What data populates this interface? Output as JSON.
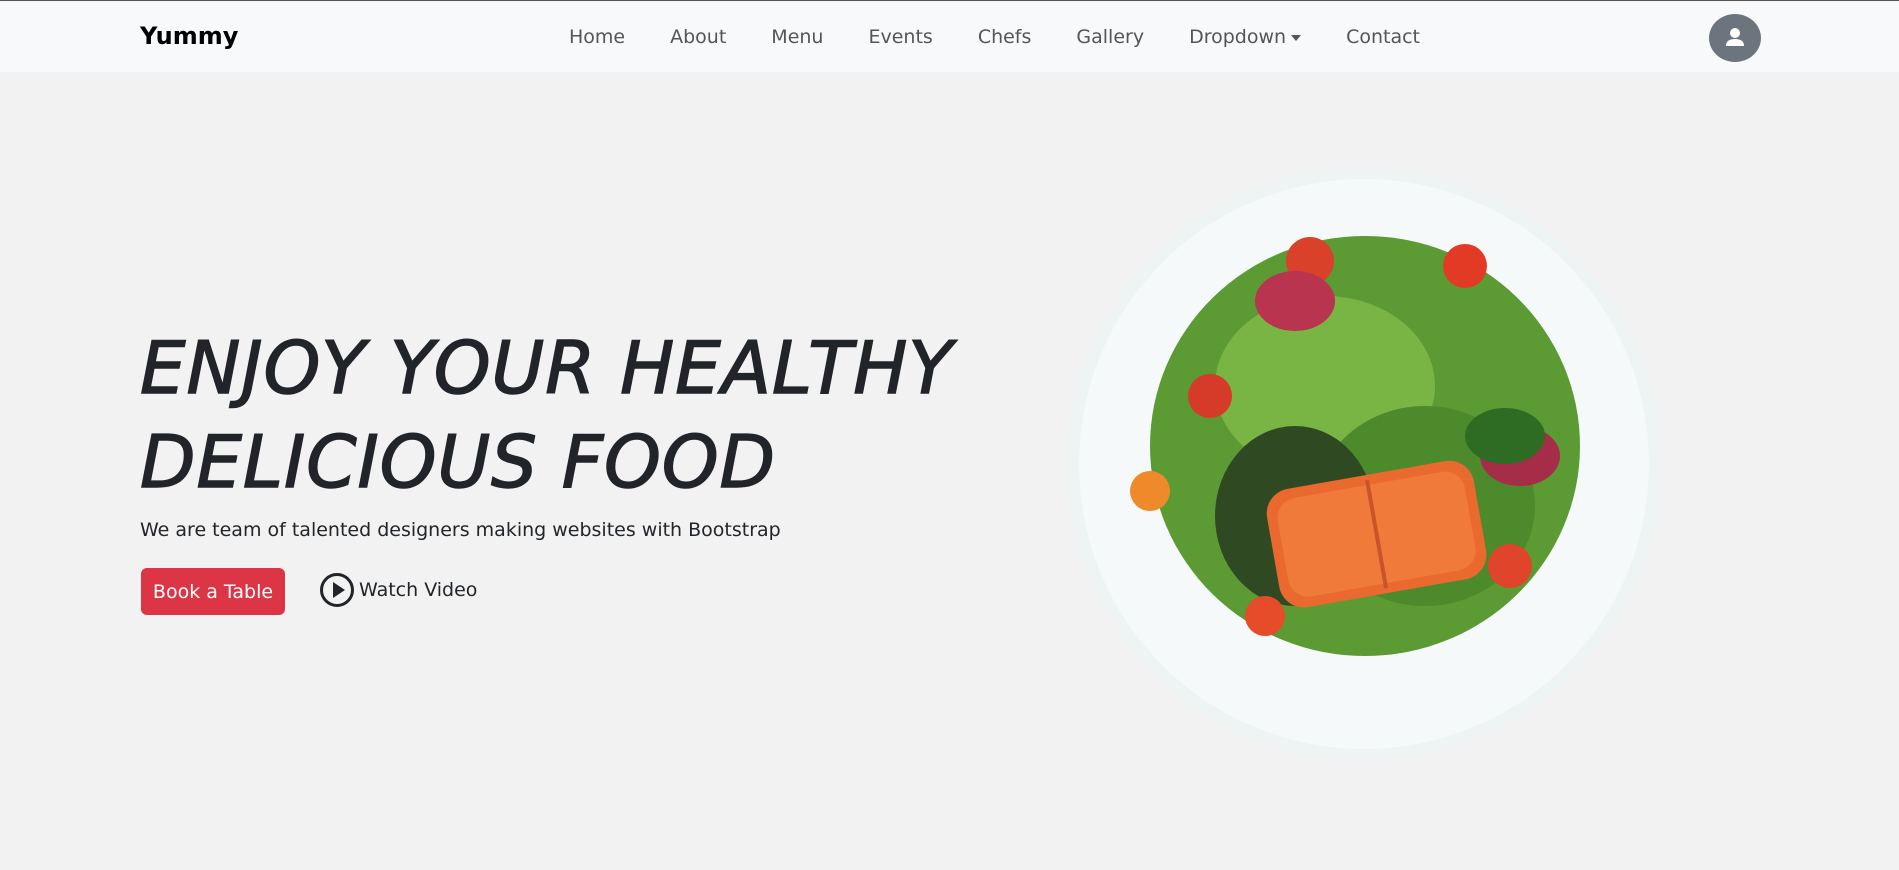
{
  "navbar": {
    "brand": "Yummy",
    "links": [
      "Home",
      "About",
      "Menu",
      "Events",
      "Chefs",
      "Gallery",
      "Dropdown",
      "Contact"
    ]
  },
  "hero": {
    "title_line1": "ENJOY YOUR HEALTHY",
    "title_line2": "DELICIOUS FOOD",
    "subtitle": "We are team of talented designers making websites with Bootstrap",
    "book_button": "Book a Table",
    "watch_video": "Watch Video"
  },
  "colors": {
    "accent": "#dc3545",
    "background": "#f2f2f2",
    "navbar": "#f8f9fa"
  }
}
